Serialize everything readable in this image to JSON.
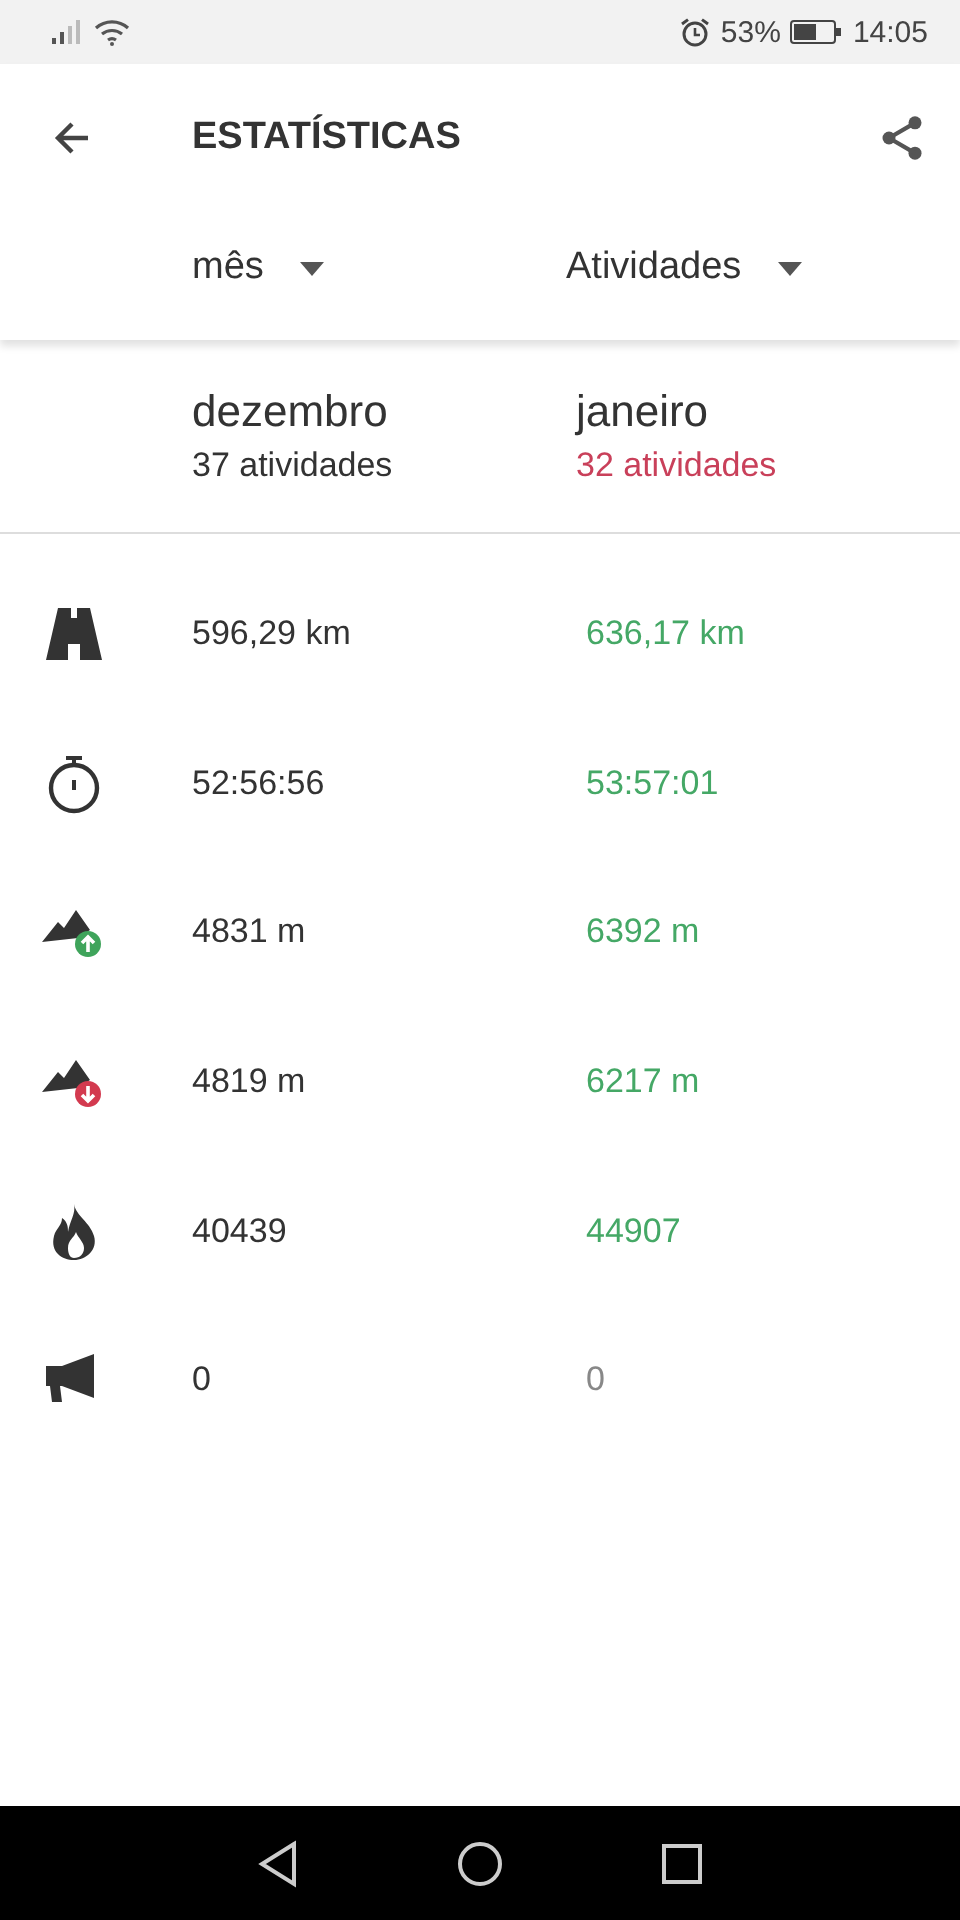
{
  "status_bar": {
    "battery_percent": "53%",
    "time": "14:05"
  },
  "header": {
    "title": "ESTATÍSTICAS"
  },
  "selectors": [
    {
      "label": "mês"
    },
    {
      "label": "Atividades"
    }
  ],
  "periods": [
    {
      "name": "dezembro",
      "count": "37 atividades",
      "color": "#333333"
    },
    {
      "name": "janeiro",
      "count": "32 atividades",
      "color": "#c9405a"
    }
  ],
  "stats": [
    {
      "kind": "distance",
      "previous": "596,29 km",
      "current": "636,17 km",
      "color": "#45a866"
    },
    {
      "kind": "time",
      "previous": "52:56:56",
      "current": "53:57:01",
      "color": "#45a866"
    },
    {
      "kind": "ascent",
      "previous": "4831 m",
      "current": "6392 m",
      "color": "#45a866"
    },
    {
      "kind": "descent",
      "previous": "4819 m",
      "current": "6217 m",
      "color": "#45a866"
    },
    {
      "kind": "calories",
      "previous": "40439",
      "current": "44907",
      "color": "#45a866"
    },
    {
      "kind": "other",
      "previous": "0",
      "current": "0",
      "color": "#888888"
    }
  ]
}
